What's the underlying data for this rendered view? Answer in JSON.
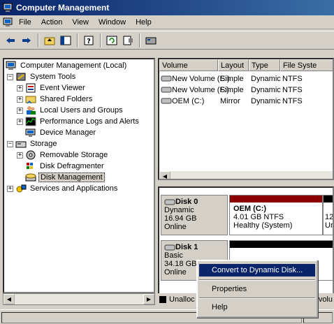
{
  "window": {
    "title": "Computer Management",
    "title_bar_color": "#0a246a"
  },
  "menu": [
    {
      "label": "File"
    },
    {
      "label": "Action"
    },
    {
      "label": "View"
    },
    {
      "label": "Window"
    },
    {
      "label": "Help"
    }
  ],
  "toolbar": {
    "buttons": [
      "back-icon",
      "forward-icon",
      "up-icon",
      "show-hide-tree-icon",
      "help-icon",
      "refresh-icon",
      "properties-icon",
      "disk-icon"
    ]
  },
  "tree": {
    "root": "Computer Management (Local)",
    "system_tools": "System Tools",
    "event_viewer": "Event Viewer",
    "shared_folders": "Shared Folders",
    "local_users": "Local Users and Groups",
    "perf_logs": "Performance Logs and Alerts",
    "device_manager": "Device Manager",
    "storage": "Storage",
    "removable_storage": "Removable Storage",
    "disk_defrag": "Disk Defragmenter",
    "disk_management": "Disk Management",
    "services": "Services and Applications"
  },
  "volumes": {
    "columns": [
      "Volume",
      "Layout",
      "Type",
      "File Syste"
    ],
    "rows": [
      {
        "volume": "New Volume (E:)",
        "layout": "Simple",
        "type": "Dynamic",
        "fs": "NTFS"
      },
      {
        "volume": "New Volume (F:)",
        "layout": "Simple",
        "type": "Dynamic",
        "fs": "NTFS"
      },
      {
        "volume": "OEM (C:)",
        "layout": "Mirror",
        "type": "Dynamic",
        "fs": "NTFS"
      }
    ]
  },
  "disks": {
    "disk0": {
      "name": "Disk 0",
      "kind": "Dynamic",
      "size": "16.94 GB",
      "status": "Online",
      "part_name": "OEM  (C:)",
      "part_size": "4.01 GB NTFS",
      "part_status": "Healthy (System)",
      "part2_size": "12",
      "part2_status": "Ur",
      "bar_color": "#8b0000"
    },
    "disk1": {
      "name": "Disk 1",
      "kind": "Basic",
      "size": "34.18 GB",
      "status": "Online",
      "bar_color": "#000000"
    }
  },
  "context_menu": {
    "convert": "Convert to Dynamic Disk...",
    "properties": "Properties",
    "help": "Help"
  },
  "legend": {
    "unallocated": "Unalloc",
    "volume_fragment": "volu"
  }
}
